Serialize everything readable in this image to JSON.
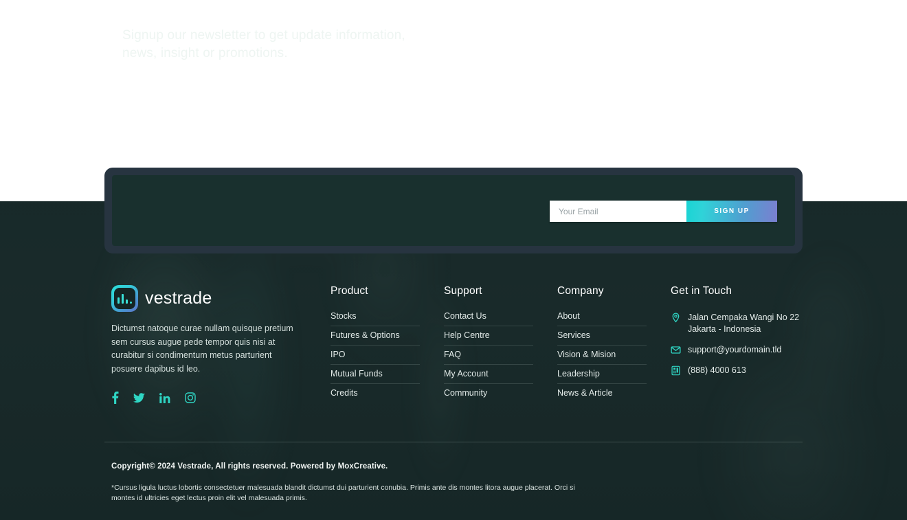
{
  "newsletter": {
    "headline_line1": "Signup our newsletter to get update information,",
    "headline_line2": "news, insight or promotions.",
    "email_placeholder": "Your Email",
    "email_value": "",
    "signup_label": "SIGN UP",
    "gradient_start": "#19d4d4",
    "gradient_end": "#7b7fd0"
  },
  "brand": {
    "name": "vestrade",
    "logo_icon": "bar-chart-logo-icon",
    "description": "Dictumst natoque curae nullam quisque pretium sem cursus augue pede tempor quis nisi at curabitur si condimentum metus parturient posuere dapibus id leo.",
    "socials": [
      {
        "name": "facebook-icon",
        "label": "Facebook"
      },
      {
        "name": "twitter-icon",
        "label": "Twitter"
      },
      {
        "name": "linkedin-icon",
        "label": "LinkedIn"
      },
      {
        "name": "instagram-icon",
        "label": "Instagram"
      }
    ]
  },
  "columns": {
    "product": {
      "title": "Product",
      "links": [
        "Stocks",
        "Futures & Options",
        "IPO",
        "Mutual Funds",
        "Credits"
      ]
    },
    "support": {
      "title": "Support",
      "links": [
        "Contact Us",
        "Help Centre",
        "FAQ",
        "My Account",
        "Community"
      ]
    },
    "company": {
      "title": "Company",
      "links": [
        "About",
        "Services",
        "Vision & Mision",
        "Leadership",
        "News & Article"
      ]
    },
    "contact": {
      "title": "Get in Touch",
      "items": [
        {
          "icon": "map-pin-icon",
          "line1": "Jalan Cempaka Wangi No 22",
          "line2": "Jakarta - Indonesia"
        },
        {
          "icon": "envelope-icon",
          "line1": "support@yourdomain.tld",
          "line2": ""
        },
        {
          "icon": "phone-icon",
          "line1": "(888) 4000 613",
          "line2": ""
        }
      ]
    }
  },
  "bottom": {
    "copyright": "Copyright© 2024 Vestrade, All rights reserved. Powered by MoxCreative.",
    "legal": "*Cursus ligula luctus lobortis consectetuer malesuada blandit dictumst dui parturient conubia. Primis ante dis montes litora augue placerat. Orci si montes id ultricies eget lectus proin elit vel malesuada primis."
  },
  "theme": {
    "footer_bg": "#1a2b2b",
    "card_outer": "#273440",
    "card_inner": "#19302e",
    "accent_teal": "#2fd6c4"
  }
}
